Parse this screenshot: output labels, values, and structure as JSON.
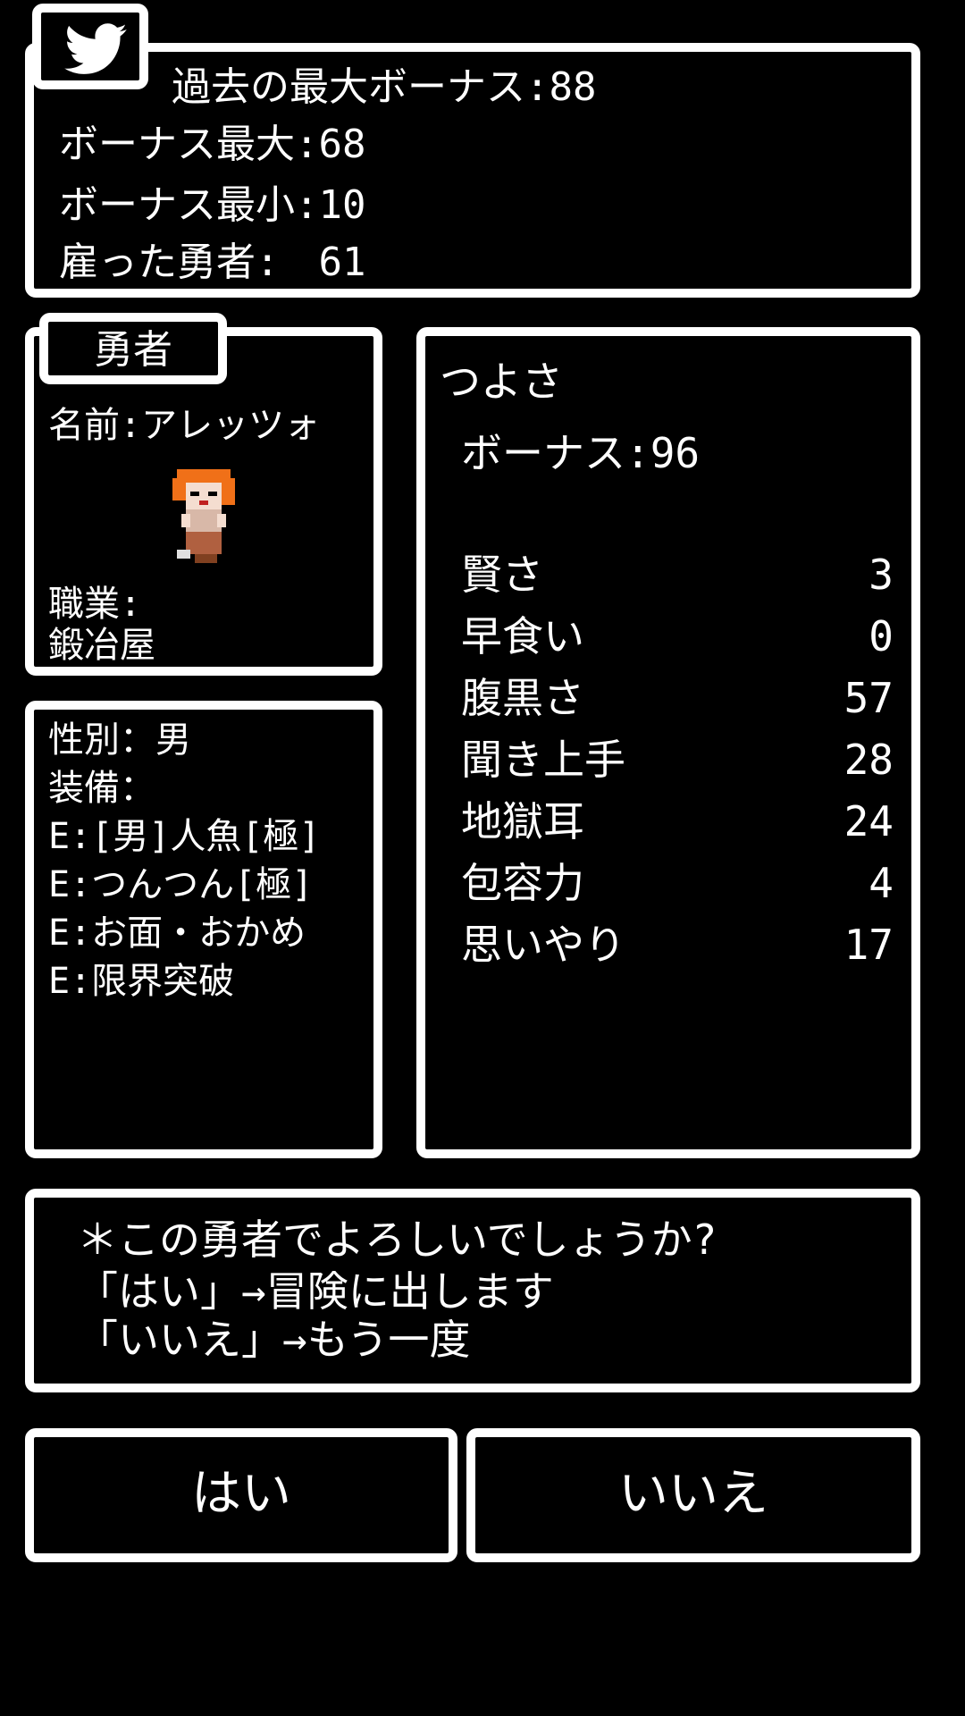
{
  "summary": {
    "max_bonus_past": "過去の最大ボーナス:88",
    "bonus_max": "ボーナス最大:68",
    "bonus_min": "ボーナス最小:10",
    "hired_heroes": "雇った勇者:　61"
  },
  "twitter_button": {
    "icon": "twitter-bird-icon"
  },
  "hero": {
    "tab_label": "勇者",
    "name_line": "名前:アレッツォ",
    "job_label": "職業:",
    "job_value": "鍛冶屋"
  },
  "equipment": {
    "gender_line": "性別：男",
    "equip_label": "装備：",
    "items": [
      "E:[男]人魚[極]",
      "E:つんつん[極]",
      "E:お面・おかめ",
      "E:限界突破"
    ]
  },
  "stats": {
    "title": "つよさ",
    "bonus_line": "ボーナス:96",
    "rows": [
      {
        "name": "賢さ",
        "value": "3"
      },
      {
        "name": "早食い",
        "value": "0"
      },
      {
        "name": "腹黒さ",
        "value": "57"
      },
      {
        "name": "聞き上手",
        "value": "28"
      },
      {
        "name": "地獄耳",
        "value": "24"
      },
      {
        "name": "包容力",
        "value": "4"
      },
      {
        "name": "思いやり",
        "value": "17"
      }
    ]
  },
  "message": {
    "line1": "＊この勇者でよろしいでしょうか?",
    "line2": "「はい」→冒険に出します",
    "line3": "「いいえ」→もう一度"
  },
  "buttons": {
    "yes_label": "はい",
    "no_label": "いいえ"
  },
  "colors": {
    "background": "#000000",
    "border": "#ffffff",
    "text": "#ffffff",
    "hero_hair": "#f07018"
  }
}
